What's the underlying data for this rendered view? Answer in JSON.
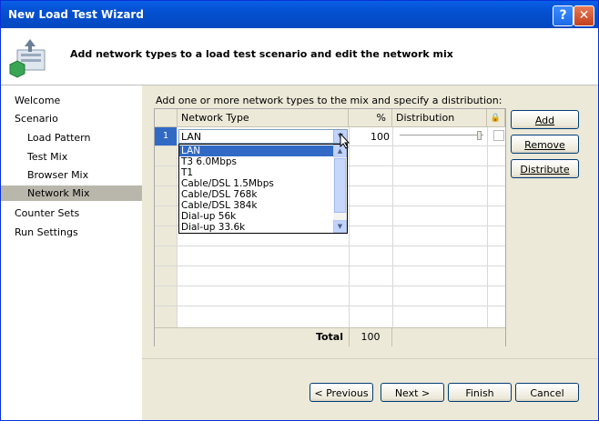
{
  "window": {
    "title": "New Load Test Wizard"
  },
  "header": {
    "text": "Add network types to a load test scenario and edit the network mix"
  },
  "nav": {
    "items": [
      {
        "label": "Welcome"
      },
      {
        "label": "Scenario"
      },
      {
        "label": "Load Pattern"
      },
      {
        "label": "Test Mix"
      },
      {
        "label": "Browser Mix"
      },
      {
        "label": "Network Mix"
      },
      {
        "label": "Counter Sets"
      },
      {
        "label": "Run Settings"
      }
    ],
    "selected": "Network Mix"
  },
  "main": {
    "instruction": "Add one or more network types to the mix and specify a distribution:",
    "grid": {
      "columns": {
        "network_type": "Network Type",
        "percent": "%",
        "distribution": "Distribution"
      },
      "row1": {
        "index": "1",
        "network_type": "LAN",
        "percent": "100"
      },
      "total_label": "Total",
      "total_value": "100"
    },
    "dropdown_options": [
      "LAN",
      "T3 6.0Mbps",
      "T1",
      "Cable/DSL 1.5Mbps",
      "Cable/DSL 768k",
      "Cable/DSL 384k",
      "Dial-up 56k",
      "Dial-up 33.6k"
    ],
    "side_buttons": {
      "add": "Add",
      "remove": "Remove",
      "distribute": "Distribute"
    }
  },
  "footer": {
    "previous": "< Previous",
    "next": "Next >",
    "finish": "Finish",
    "cancel": "Cancel"
  }
}
